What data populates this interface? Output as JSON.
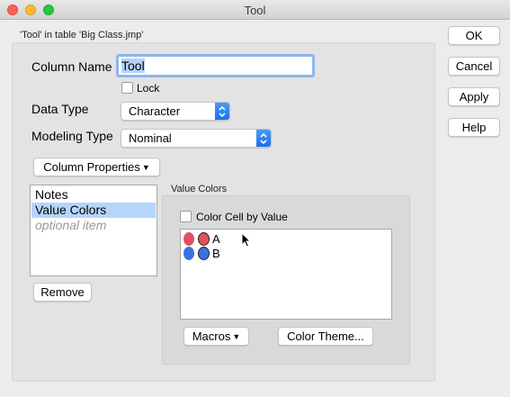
{
  "window": {
    "title": "Tool"
  },
  "subtitle": "'Tool' in table 'Big Class.jmp'",
  "form": {
    "column_name_label": "Column Name",
    "column_name_value": "Tool",
    "lock_label": "Lock",
    "lock_checked": false,
    "data_type_label": "Data Type",
    "data_type_value": "Character",
    "modeling_type_label": "Modeling Type",
    "modeling_type_value": "Nominal",
    "column_properties_label": "Column Properties"
  },
  "properties_list": {
    "items": [
      {
        "label": "Notes"
      },
      {
        "label": "Value Colors"
      },
      {
        "label": "optional item"
      }
    ],
    "selected_index": 1,
    "remove_label": "Remove"
  },
  "value_colors": {
    "title": "Value Colors",
    "color_cell_label": "Color Cell by Value",
    "color_cell_checked": false,
    "values": [
      {
        "label": "A",
        "color": "#e05060"
      },
      {
        "label": "B",
        "color": "#3a73e0"
      }
    ],
    "macros_label": "Macros",
    "color_theme_label": "Color Theme..."
  },
  "side_buttons": {
    "ok": "OK",
    "cancel": "Cancel",
    "apply": "Apply",
    "help": "Help"
  }
}
